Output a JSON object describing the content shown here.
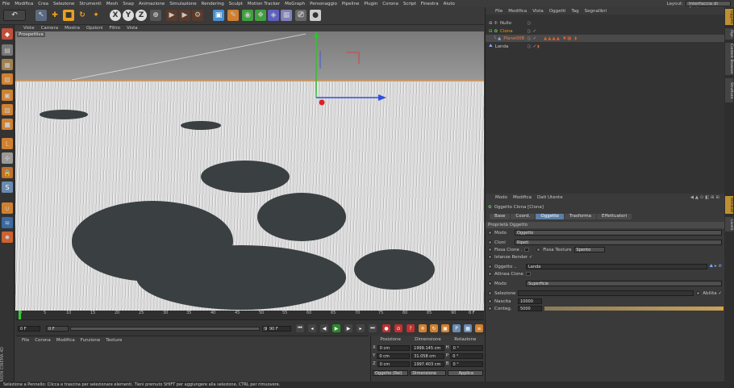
{
  "menubar": {
    "items": [
      "File",
      "Modifica",
      "Crea",
      "Selezione",
      "Strumenti",
      "Mesh",
      "Snap",
      "Animazione",
      "Simulazione",
      "Rendering",
      "Sculpt",
      "Motion Tracker",
      "MoGraph",
      "Personaggio",
      "Pipeline",
      "Plugin",
      "Corona",
      "Script",
      "Finestra",
      "Aiuto"
    ],
    "layout_label": "Layout:",
    "layout_value": "Interfaccia di Avvio"
  },
  "viewport": {
    "menu": [
      "Viste",
      "Camera",
      "Mostra",
      "Opzioni",
      "Filtro",
      "Vista"
    ],
    "label": "Prospettiva"
  },
  "timeline": {
    "ticks": [
      "0",
      "5",
      "10",
      "15",
      "20",
      "25",
      "30",
      "35",
      "40",
      "45",
      "50",
      "55",
      "60",
      "65",
      "70",
      "75",
      "80",
      "85",
      "90"
    ],
    "end_marker": "0 F"
  },
  "playback": {
    "current": "0 F",
    "start": "0 F",
    "end": "90 F",
    "end2": "90 F"
  },
  "material": {
    "menu": [
      "File",
      "Corona",
      "Modifica",
      "Funzione",
      "Texture"
    ]
  },
  "coords": {
    "headers": [
      "Posizione",
      "Dimensione",
      "Rotazione"
    ],
    "rows": [
      {
        "axis": "X",
        "pos": "0 cm",
        "size": "1999.145 cm",
        "rot_axis": "H",
        "rot": "0 °"
      },
      {
        "axis": "Y",
        "pos": "0 cm",
        "size": "31.058 cm",
        "rot_axis": "P",
        "rot": "0 °"
      },
      {
        "axis": "Z",
        "pos": "0 cm",
        "size": "1997.403 cm",
        "rot_axis": "B",
        "rot": "0 °"
      }
    ],
    "mode1": "Oggetto (Rel)",
    "mode2": "Dimensione",
    "apply": "Applica"
  },
  "objects": {
    "menu": [
      "File",
      "Modifica",
      "Vista",
      "Oggetti",
      "Tag",
      "Segnalibri"
    ],
    "rows": [
      {
        "name": "Nullo"
      },
      {
        "name": "Clona"
      },
      {
        "name": "Plane00B"
      },
      {
        "name": "Landa"
      }
    ]
  },
  "attributes": {
    "menu": [
      "Modo",
      "Modifica",
      "Dati Utente"
    ],
    "title": "Oggetto Clona [Clona]",
    "tabs": [
      "Base",
      "Coord.",
      "Oggetto",
      "Trasforma",
      "Effettuatori"
    ],
    "section": "Proprietà Oggetto",
    "mode_label": "Modo",
    "mode_value": "Oggetto",
    "cloni_label": "Cloni",
    "cloni_value": "Ripeti",
    "fissa_clone": "Fissa Clone .",
    "fissa_texture": "Fissa Texture",
    "fissa_texture_value": "Spento",
    "istanze": "Istanze Render ✓",
    "oggetto_label": "Oggetto ..",
    "oggetto_value": "Landa",
    "allinea": "Allinea Clone",
    "distr_label": "Modo",
    "distr_value": "Superficie",
    "selezione": "Selezione",
    "abilita": "Abilita ✓",
    "nascita_label": "Nascita",
    "nascita_value": "10000",
    "conteggio_label": "Conteg.",
    "conteggio_value": "5000"
  },
  "sidetabs": [
    "Oggetti",
    "Ripr.",
    "Content Browser",
    "Struttura",
    "Attributi",
    "Livelli"
  ],
  "status": "Selezione a Pennello: Clicca e trascina per selezionare elementi. Tieni premuto SHIFT per aggiungere alla selezione, CTRL per rimuovere.",
  "logo": "MAXON CINEMA 4D"
}
